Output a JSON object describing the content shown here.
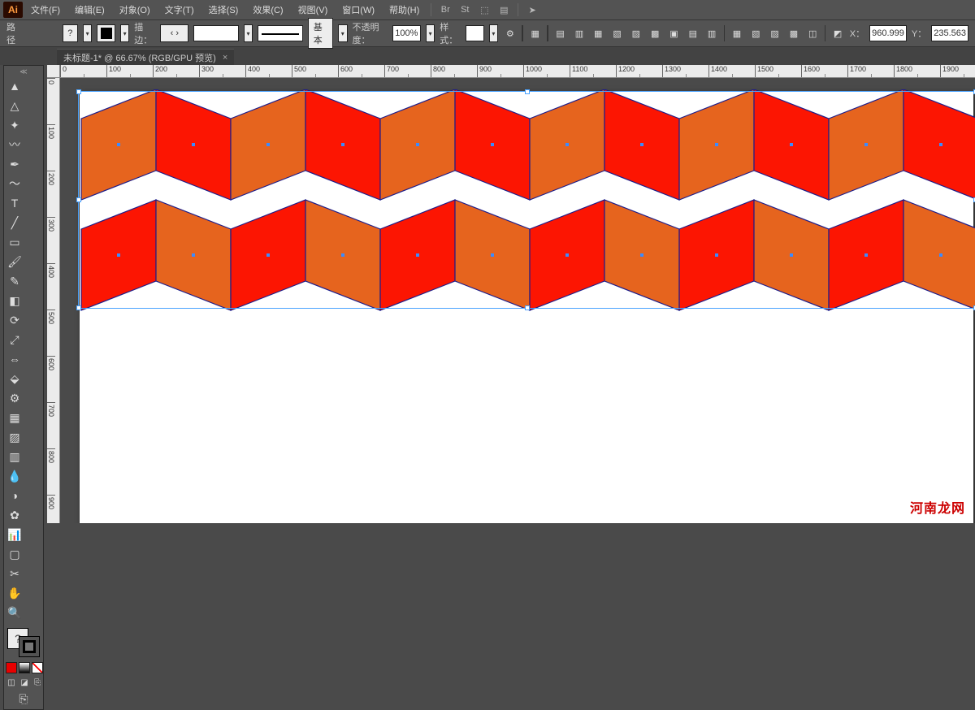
{
  "app": {
    "name": "Ai"
  },
  "menu": {
    "file": "文件(F)",
    "edit": "编辑(E)",
    "object": "对象(O)",
    "type": "文字(T)",
    "select": "选择(S)",
    "effect": "效果(C)",
    "view": "视图(V)",
    "window": "窗口(W)",
    "help": "帮助(H)"
  },
  "control": {
    "mode_label": "路径",
    "question": "?",
    "stroke_label": "描边：",
    "brush_label": "基本",
    "opacity_label": "不透明度：",
    "opacity_value": "100%",
    "style_label": "样式：",
    "x_label": "X：",
    "x_value": "960.999",
    "y_label": "Y：",
    "y_value": "235.563"
  },
  "tab": {
    "title": "未标题-1* @ 66.67% (RGB/GPU 预览)",
    "close": "×"
  },
  "ruler": {
    "h": [
      "0",
      "100",
      "200",
      "300",
      "400",
      "500",
      "600",
      "700",
      "800",
      "900",
      "1000",
      "1100",
      "1200",
      "1300",
      "1400",
      "1500",
      "1600",
      "1700",
      "1800",
      "1900"
    ],
    "v": [
      "0",
      "100",
      "200",
      "300",
      "400",
      "500",
      "600",
      "700",
      "800",
      "900"
    ]
  },
  "watermark": "河南龙网",
  "icons": {
    "bridge": "Br",
    "stock": "St",
    "arrange": "⬚",
    "cloud": "▤",
    "rocket": "➤",
    "selection": "▲",
    "direct": "△",
    "wand": "✦",
    "lasso": "〰",
    "pen": "✒",
    "curv": "〜",
    "type": "T",
    "line": "╱",
    "rect": "▭",
    "brush": "🖌",
    "pencil": "✎",
    "eraser": "◧",
    "rotate": "⟳",
    "scale": "⤢",
    "width": "⇔",
    "free": "⬙",
    "shapeb": "⚙",
    "persp": "▦",
    "mesh": "▨",
    "grad": "▥",
    "eyed": "💧",
    "blend": "◑",
    "symbol": "✿",
    "graph": "📊",
    "artb": "▢",
    "slice": "✂",
    "hand": "✋",
    "zoom": "🔍",
    "mode1": "◫",
    "mode2": "◪",
    "paper": "⎘",
    "chain": "⚙",
    "grid": "▦",
    "al1": "▤",
    "al2": "▥",
    "al3": "▦",
    "al4": "▧",
    "al5": "▨",
    "al6": "▩",
    "al7": "▣",
    "al8": "▤",
    "al9": "▥",
    "al10": "▦",
    "al11": "▧",
    "al12": "▨",
    "al13": "▩",
    "al14": "◫",
    "al15": "◩",
    "al16": "◪",
    "al17": "▤"
  }
}
